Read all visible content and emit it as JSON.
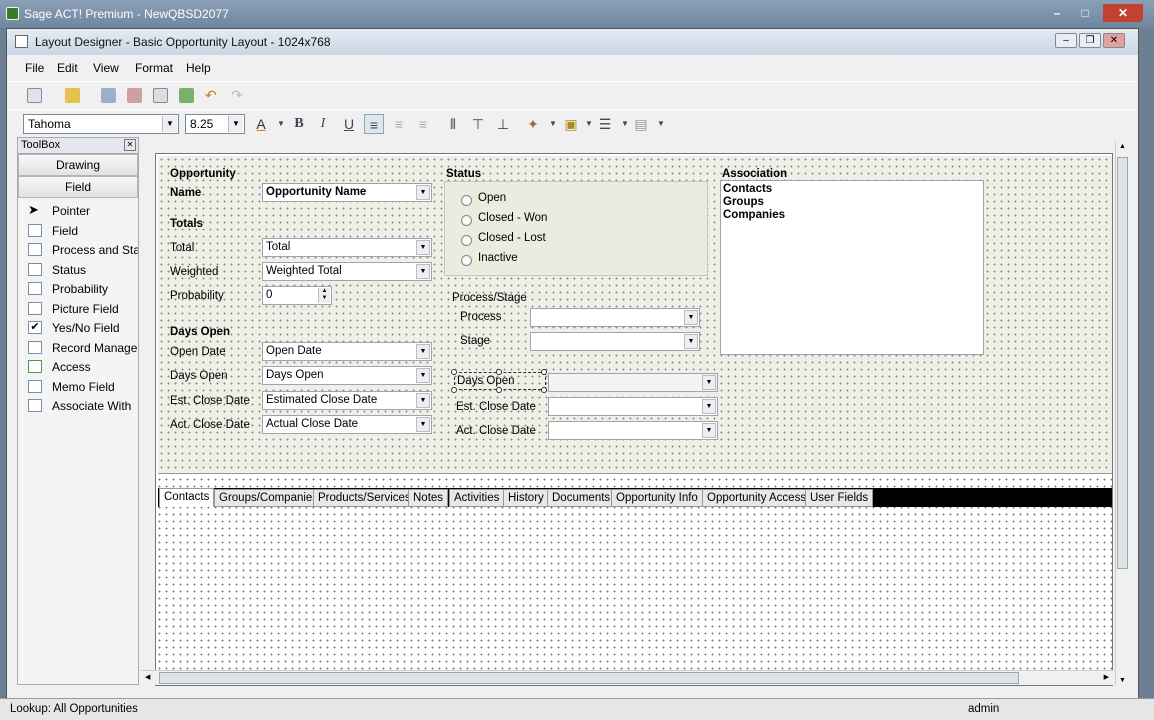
{
  "app": {
    "title": "Sage ACT! Premium - NewQBSD2077"
  },
  "designer": {
    "title": "Layout Designer - Basic Opportunity Layout - 1024x768"
  },
  "menu": [
    "File",
    "Edit",
    "View",
    "Format",
    "Help"
  ],
  "format_bar": {
    "font": "Tahoma",
    "size": "8.25"
  },
  "toolbox": {
    "title": "ToolBox",
    "tabs": [
      "Drawing",
      "Field"
    ],
    "items": [
      "Pointer",
      "Field",
      "Process and Stage",
      "Status",
      "Probability",
      "Picture Field",
      "Yes/No Field",
      "Record Manager",
      "Access",
      "Memo Field",
      "Associate With"
    ]
  },
  "form": {
    "opportunity_heading": "Opportunity",
    "name_label": "Name",
    "name_value": "Opportunity Name",
    "totals_heading": "Totals",
    "total_label": "Total",
    "total_value": "Total",
    "weighted_label": "Weighted",
    "weighted_value": "Weighted Total",
    "probability_label": "Probability",
    "probability_value": "0",
    "days_open_heading": "Days Open",
    "open_date_label": "Open Date",
    "open_date_value": "Open Date",
    "days_open_label": "Days Open",
    "days_open_value": "Days Open",
    "est_close_label": "Est. Close Date",
    "est_close_value": "Estimated Close Date",
    "act_close_label": "Act. Close Date",
    "act_close_value": "Actual Close Date",
    "status_heading": "Status",
    "status_options": [
      "Open",
      "Closed - Won",
      "Closed - Lost",
      "Inactive"
    ],
    "process_stage_heading": "Process/Stage",
    "process_label": "Process",
    "stage_label": "Stage",
    "mid_days_open": "Days Open",
    "mid_est_close": "Est. Close Date",
    "mid_act_close": "Act. Close Date",
    "association_heading": "Association",
    "association_items": [
      "Contacts",
      "Groups",
      "Companies"
    ]
  },
  "tabs": [
    "Contacts",
    "Groups/Companies",
    "Products/Services",
    "Notes",
    "Activities",
    "History",
    "Documents",
    "Opportunity Info",
    "Opportunity Access",
    "User Fields"
  ],
  "status": {
    "lookup": "Lookup: All Opportunities",
    "user": "admin"
  }
}
